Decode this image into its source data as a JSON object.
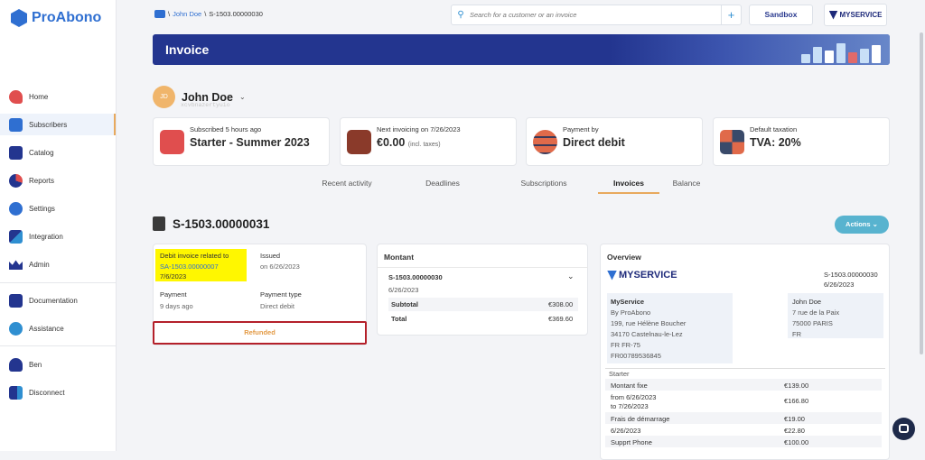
{
  "app": {
    "name": "ProAbono"
  },
  "sidebar": {
    "items": [
      {
        "label": "Home",
        "icon": "rocket-icon"
      },
      {
        "label": "Subscribers",
        "icon": "subscribers-icon"
      },
      {
        "label": "Catalog",
        "icon": "catalog-icon"
      },
      {
        "label": "Reports",
        "icon": "pie-chart-icon"
      },
      {
        "label": "Settings",
        "icon": "gear-icon"
      },
      {
        "label": "Integration",
        "icon": "code-icon"
      },
      {
        "label": "Admin",
        "icon": "crown-icon"
      },
      {
        "label": "Documentation",
        "icon": "book-icon"
      },
      {
        "label": "Assistance",
        "icon": "headset-icon"
      },
      {
        "label": "Ben",
        "icon": "user-icon"
      },
      {
        "label": "Disconnect",
        "icon": "logout-icon"
      }
    ]
  },
  "breadcrumb": {
    "sep1": "\\",
    "user": "John Doe",
    "sep2": "\\",
    "current": "S-1503.00000030"
  },
  "search": {
    "placeholder": "Search for a customer or an invoice"
  },
  "topbar": {
    "sandbox": "Sandbox",
    "brand": "MYSERVICE"
  },
  "banner": {
    "title": "Invoice"
  },
  "customer": {
    "initials": "JD",
    "name": "John Doe",
    "id": "xcvbnazertyuio"
  },
  "stats": [
    {
      "label": "Subscribed 5 hours ago",
      "value": "Starter - Summer 2023",
      "sub": "",
      "color": "#e04e4e"
    },
    {
      "label": "Next invoicing on 7/26/2023",
      "value": "€0.00",
      "sub": "(incl. taxes)",
      "color": "#8a3a2a"
    },
    {
      "label": "Payment by",
      "value": "Direct debit",
      "sub": "",
      "color": "#e06a4a"
    },
    {
      "label": "Default taxation",
      "value": "TVA: 20%",
      "sub": "",
      "color": "#3a4a6a"
    }
  ],
  "tabs": [
    "Recent activity",
    "Deadlines",
    "Subscriptions",
    "Invoices",
    "Balance"
  ],
  "invoice": {
    "number": "S-1503.00000031",
    "actions": "Actions",
    "related_label": "Debit invoice related to",
    "related_number": "SA-1503.00000007",
    "related_date": "7/6/2023",
    "issued_label": "Issued",
    "issued_value": "on 6/26/2023",
    "payment_label": "Payment",
    "payment_value": "9 days ago",
    "payment_type_label": "Payment type",
    "payment_type_value": "Direct debit",
    "status": "Refunded"
  },
  "montant": {
    "title": "Montant",
    "ref": "S-1503.00000030",
    "date": "6/26/2023",
    "subtotal_label": "Subtotal",
    "subtotal_value": "€308.00",
    "total_label": "Total",
    "total_value": "€369.60"
  },
  "overview": {
    "title": "Overview",
    "brand": "MYSERVICE",
    "ref": "S-1503.00000030",
    "date": "6/26/2023",
    "seller": [
      "MyService",
      "By ProAbono",
      "199, rue Hélène Boucher",
      "34170  Castelnau-le-Lez",
      "FR  FR-75",
      "FR00789536845"
    ],
    "buyer": [
      "John Doe",
      "7 rue de la Paix",
      "75000  PARIS",
      "FR"
    ],
    "section": "Starter",
    "lines": [
      {
        "label": "Montant fixe",
        "value": "€139.00"
      },
      {
        "label": "from 6/26/2023",
        "value": "€166.80"
      },
      {
        "label": "to 7/26/2023",
        "value": ""
      },
      {
        "label": "Frais de démarrage",
        "value": "€19.00"
      },
      {
        "label": "6/26/2023",
        "value": "€22.80"
      },
      {
        "label": "Supprt Phone",
        "value": "€100.00"
      }
    ]
  }
}
